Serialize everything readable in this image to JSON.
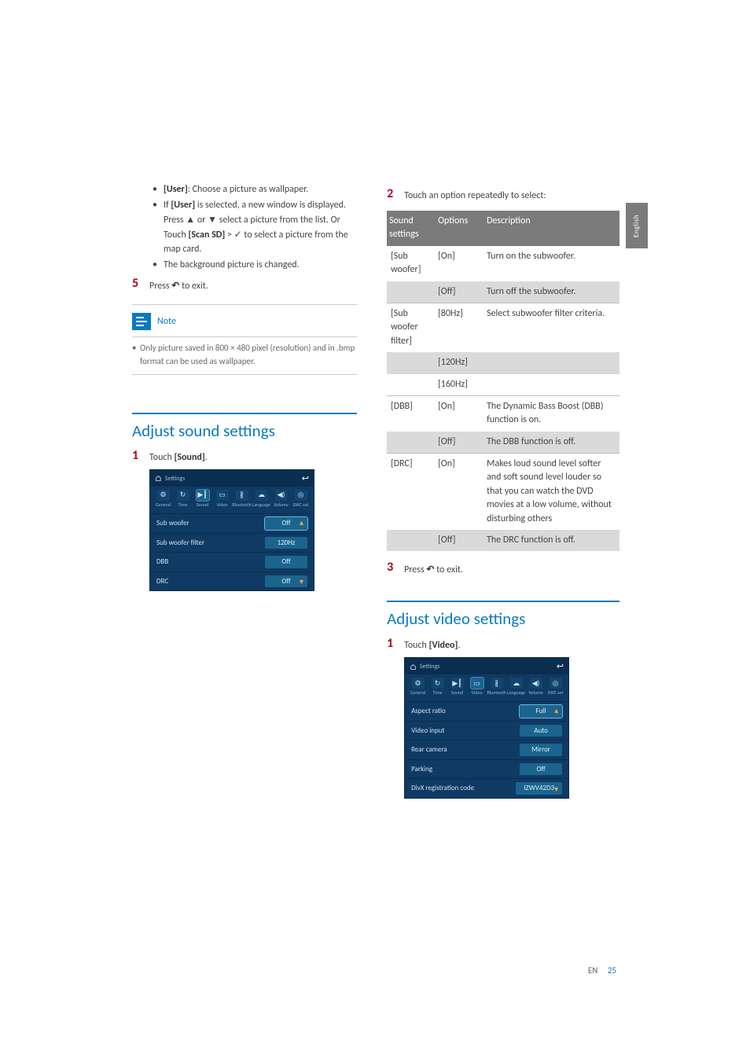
{
  "lang_tab": "English",
  "footer": {
    "lang": "EN",
    "page": "25"
  },
  "left": {
    "bullets": [
      {
        "bold": "[User]",
        "text": ": Choose a picture as wallpaper."
      },
      {
        "prefix": "If ",
        "bold": "[User]",
        "text": " is selected, a new window is displayed.",
        "sub1_pre": "Press ",
        "sub1_mid": " or ",
        "sub1_post": " select a picture from the list. Or",
        "sub2_pre": "Touch ",
        "sub2_bold": "[Scan SD]",
        "sub2_mid": " > ",
        "sub2_post": " to select a picture from the map card."
      },
      {
        "text": "The background picture is changed."
      }
    ],
    "step5": {
      "num": "5",
      "pre": "Press ",
      "post": " to exit."
    },
    "note": {
      "label": "Note",
      "body": "Only picture saved in 800 × 480 pixel (resolution) and in .bmp format can be used as wallpaper."
    },
    "sound_heading": "Adjust sound settings",
    "sound_step1": {
      "num": "1",
      "pre": "Touch ",
      "bold": "[Sound]",
      "post": "."
    },
    "shot_sound": {
      "title": "Settings",
      "tabs": [
        "General",
        "Time",
        "Sound",
        "Video",
        "Bluetooth",
        "Language",
        "Volume",
        "SWC set"
      ],
      "active_tab": 2,
      "tab_icons": [
        "⚙",
        "↻",
        "▶┃",
        "▭",
        "∦",
        "☁",
        "◀)",
        "◎"
      ],
      "rows": [
        {
          "label": "Sub woofer",
          "value": "Off",
          "highlight": true
        },
        {
          "label": "Sub woofer filter",
          "value": "120Hz"
        },
        {
          "label": "DBB",
          "value": "Off"
        },
        {
          "label": "DRC",
          "value": "Off"
        }
      ]
    }
  },
  "right": {
    "step2": {
      "num": "2",
      "text": "Touch an option repeatedly to select:"
    },
    "table": {
      "head": [
        "Sound settings",
        "Options",
        "Description"
      ],
      "rows": [
        {
          "c1": "[Sub woofer]",
          "c2": "[On]",
          "c3": "Turn on the subwoofer.",
          "cls": ""
        },
        {
          "c1": "",
          "c2": "[Off]",
          "c3": "Turn off the subwoofer.",
          "cls": "shade"
        },
        {
          "c1": "[Sub woofer filter]",
          "c2": "[80Hz]",
          "c3": "Select subwoofer filter criteria.",
          "cls": "line"
        },
        {
          "c1": "",
          "c2": "[120Hz]",
          "c3": "",
          "cls": "shade"
        },
        {
          "c1": "",
          "c2": "[160Hz]",
          "c3": "",
          "cls": ""
        },
        {
          "c1": "[DBB]",
          "c2": "[On]",
          "c3": "The Dynamic Bass Boost (DBB) function is on.",
          "cls": "line"
        },
        {
          "c1": "",
          "c2": "[Off]",
          "c3": "The DBB function is off.",
          "cls": "shade"
        },
        {
          "c1": "[DRC]",
          "c2": "[On]",
          "c3": "Makes loud sound level softer and soft sound level louder so that you can watch the DVD movies at a low volume, without disturbing others",
          "cls": "line"
        },
        {
          "c1": "",
          "c2": "[Off]",
          "c3": "The DRC function is off.",
          "cls": "shade"
        }
      ]
    },
    "step3": {
      "num": "3",
      "pre": "Press ",
      "post": " to exit."
    },
    "video_heading": "Adjust video settings",
    "video_step1": {
      "num": "1",
      "pre": "Touch ",
      "bold": "[Video]",
      "post": "."
    },
    "shot_video": {
      "title": "Settings",
      "tabs": [
        "General",
        "Time",
        "Sound",
        "Video",
        "Bluetooth",
        "Language",
        "Volume",
        "SWC set"
      ],
      "active_tab": 3,
      "tab_icons": [
        "⚙",
        "↻",
        "▶┃",
        "▭",
        "∦",
        "☁",
        "◀)",
        "◎"
      ],
      "rows": [
        {
          "label": "Aspect ratio",
          "value": "Full",
          "highlight": true
        },
        {
          "label": "Video input",
          "value": "Auto"
        },
        {
          "label": "Rear camera",
          "value": "Mirror"
        },
        {
          "label": "Parking",
          "value": "Off"
        },
        {
          "label": "DivX registration code",
          "value": "IZWV42D3"
        }
      ]
    }
  },
  "glyphs": {
    "up": "▲",
    "down": "▼",
    "check": "✓",
    "back": "↶",
    "home": "⌂",
    "return": "↩",
    "arrow_up_small": "▴",
    "arrow_down_small": "▾"
  }
}
